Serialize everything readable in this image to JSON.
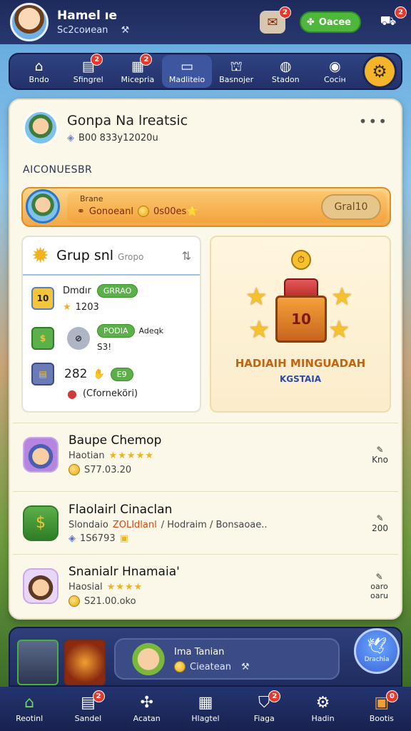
{
  "header": {
    "player_name": "Hamel ıe",
    "player_sub": "Sс2соиеаn",
    "clover_label": "Оасее",
    "mail_badge": "2",
    "gift_badge": "2"
  },
  "nav": {
    "items": [
      {
        "icon": "home-icon",
        "label": "Bndo",
        "badge": ""
      },
      {
        "icon": "clipboard-icon",
        "label": "Sfingrel",
        "badge": "2"
      },
      {
        "icon": "note-icon",
        "label": "Micepria",
        "badge": "2"
      },
      {
        "icon": "chat-icon",
        "label": "Madliteio",
        "badge": ""
      },
      {
        "icon": "house-icon",
        "label": "Basnojer",
        "badge": ""
      },
      {
        "icon": "pot-icon",
        "label": "Stadon",
        "badge": ""
      },
      {
        "icon": "globe-icon",
        "label": "Сосін",
        "badge": ""
      }
    ]
  },
  "group": {
    "title": "Gonpa Na lreatsic",
    "sub": "B00 833y12020u",
    "section_label": "AICONUESBR"
  },
  "reward": {
    "small_text": "Brane",
    "line_text": "Gonoeanl",
    "coin_value": "0s00es⭐",
    "claim_label": "Gral10"
  },
  "left_card": {
    "title": "Grup snl",
    "tag": "Gropo",
    "row1_name": "Dmdır",
    "row1_pill": "GRRAO",
    "row1_value": "1203",
    "row2_pill": "PODIA",
    "row2_text": "Adeqk",
    "row2_sub": "S3!",
    "row3_value": "282",
    "row3_pill": "E9",
    "row4_text": "(Cforneköri)"
  },
  "right_card": {
    "chest_number": "10",
    "title": "HADIAIH MINGUADAH",
    "subtitle": "KGSTAIA"
  },
  "friends": [
    {
      "name": "Baupe Chemop",
      "role": "Haotian",
      "stars": "★★★★★",
      "coins": "S77.03.20",
      "right": "Kno"
    },
    {
      "name": "Flaolairl Cinaclan",
      "role": "Slondaio",
      "extra": "ZOLIdlanl",
      "extra2": "/ Hodraim / Bonsaoae..",
      "coins": "1S6793",
      "right": "200"
    },
    {
      "name": "Snanialr Hnamaia'",
      "role": "Haosial",
      "stars": "★★★★",
      "coins": "S21.00.oko",
      "right": "oaro\noaru"
    }
  ],
  "profile": {
    "name": "Ima Tanian",
    "sub": "Cieatean",
    "bird_label": "Drachia"
  },
  "bottomnav": {
    "items": [
      {
        "icon": "home-icon",
        "label": "Reotinl",
        "badge": ""
      },
      {
        "icon": "clipboard-icon",
        "label": "Sandel",
        "badge": "2"
      },
      {
        "icon": "puzzle-icon",
        "label": "Acatan",
        "badge": ""
      },
      {
        "icon": "board-icon",
        "label": "Hlagtel",
        "badge": ""
      },
      {
        "icon": "bag-icon",
        "label": "Fiaga",
        "badge": "2"
      },
      {
        "icon": "gear-icon",
        "label": "Hadin",
        "badge": ""
      },
      {
        "icon": "shop-icon",
        "label": "Bootis",
        "badge": "0"
      }
    ]
  }
}
